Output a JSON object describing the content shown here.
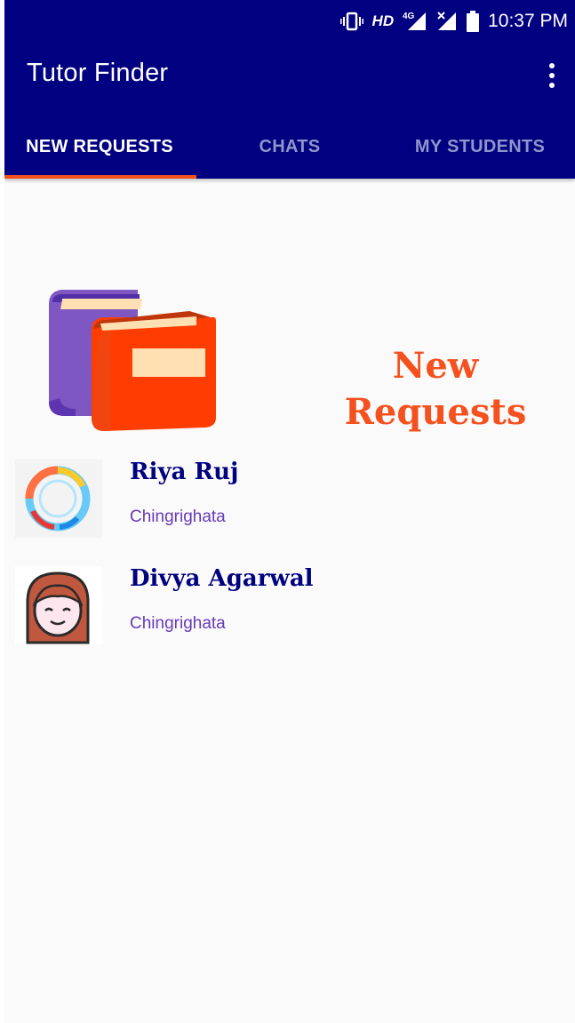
{
  "status_bar": {
    "network_label": "HD",
    "network_gen": "4G",
    "time": "10:37 PM",
    "icons": [
      "vibrate-icon",
      "signal-icon",
      "no-signal-icon",
      "battery-icon"
    ]
  },
  "app_bar": {
    "title": "Tutor Finder",
    "menu_icon": "overflow-menu-icon"
  },
  "tabs": [
    {
      "label": "NEW REQUESTS",
      "active": true
    },
    {
      "label": "CHATS",
      "active": false
    },
    {
      "label": "MY STUDENTS",
      "active": false
    }
  ],
  "banner": {
    "icon": "books-icon",
    "heading_line1": "New",
    "heading_line2": "Requests"
  },
  "requests": [
    {
      "name": "Riya Ruj",
      "location": "Chingrighata",
      "avatar": "swirl-avatar"
    },
    {
      "name": "Divya Agarwal",
      "location": "Chingrighata",
      "avatar": "girl-face-avatar"
    }
  ],
  "colors": {
    "primary": "#000080",
    "accent": "#f4511e",
    "location_text": "#673ab7",
    "background": "#fafafa"
  }
}
